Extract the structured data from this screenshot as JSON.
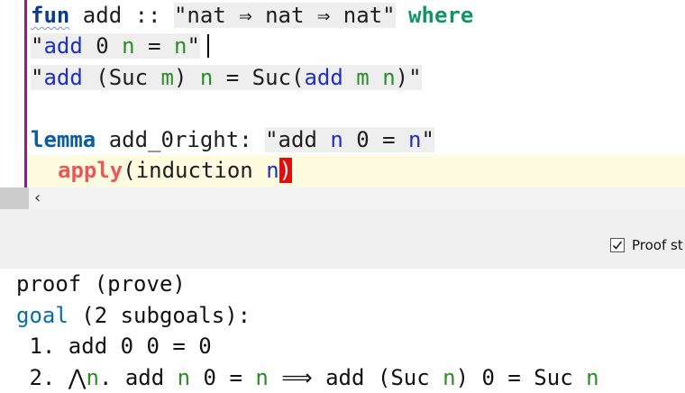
{
  "editor": {
    "line1": {
      "kw_fun": "fun",
      "name": " add :: ",
      "type_str": "\"nat ⇒ nat ⇒ nat\"",
      "kw_where": "where"
    },
    "line2": {
      "q1": "\"",
      "add": "add",
      "mid1": " 0 ",
      "n1": "n",
      "eq": " = ",
      "n2": "n",
      "q2": "\""
    },
    "line3": {
      "q1": "\"",
      "add1": "add",
      "mid1": " (Suc ",
      "m1": "m",
      "mid2": ") ",
      "n1": "n",
      "mid3": " = Suc(",
      "add2": "add",
      "sp": " ",
      "m2": "m",
      "sp2": " ",
      "n2": "n",
      "q2": ")\""
    },
    "line5": {
      "kw_lemma": "lemma",
      "name": " add_0right: ",
      "q1": "\"add ",
      "n1": "n",
      "mid": " 0 = ",
      "n2": "n",
      "q2": "\""
    },
    "line6": {
      "kw_apply": "apply",
      "open": "(",
      "body": "induction ",
      "n": "n",
      "close": ")"
    }
  },
  "scroll": {
    "left_arrow": "‹"
  },
  "toolbar": {
    "proof_state_checked": true,
    "proof_state_label": "Proof st"
  },
  "output": {
    "line1": "proof (prove)",
    "line2_kw": "goal",
    "line2_rest": " (2 subgoals):",
    "line3": " 1. add 0 0 = 0",
    "line4": {
      "pre": " 2. ⋀",
      "n1": "n",
      "mid1": ". add ",
      "n2": "n",
      "mid2": " 0 = ",
      "n3": "n",
      "mid3": " ⟹ add (Suc ",
      "n4": "n",
      "mid4": ") 0 = Suc ",
      "n5": "n"
    }
  },
  "colors": {
    "gutter": "#8b1d8b",
    "keyword_def": "#0b3c8c",
    "keyword_where": "#13936a",
    "keyword_apply": "#e85a5a",
    "free_var": "#1f2fbf",
    "bound_var": "#2c8c25",
    "paren_match": "#e30d0d"
  }
}
